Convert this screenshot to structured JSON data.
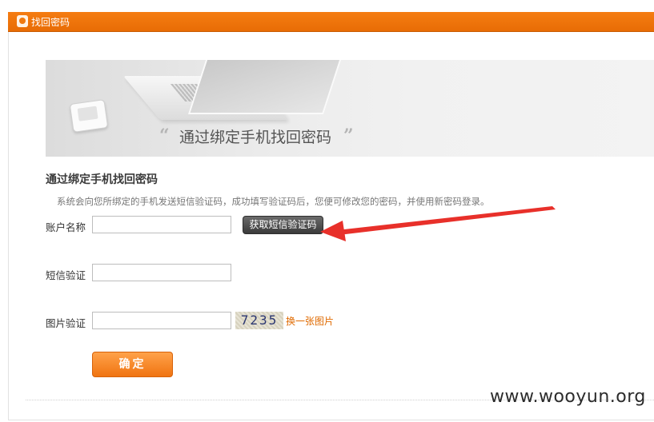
{
  "header": {
    "title": "找回密码",
    "icon": "key-icon",
    "color": "#f07a10"
  },
  "banner": {
    "open_quote": "“",
    "text": "通过绑定手机找回密码",
    "close_quote": "”"
  },
  "form": {
    "section_title": "通过绑定手机找回密码",
    "description": "系统会向您所绑定的手机发送短信验证码，成功填写验证码后，您便可修改您的密码，并使用新密码登录。",
    "account": {
      "label": "账户名称",
      "value": "",
      "placeholder": ""
    },
    "sms_button": "获取短信验证码",
    "sms_code": {
      "label": "短信验证",
      "value": "",
      "placeholder": ""
    },
    "image_code": {
      "label": "图片验证",
      "value": "",
      "placeholder": ""
    },
    "captcha_text": "7235",
    "change_captcha": "换一张图片",
    "submit": "确定",
    "submit_color": "#f07411"
  },
  "annotation": {
    "arrow_color": "#e8302a"
  },
  "watermark": "www.wooyun.org"
}
